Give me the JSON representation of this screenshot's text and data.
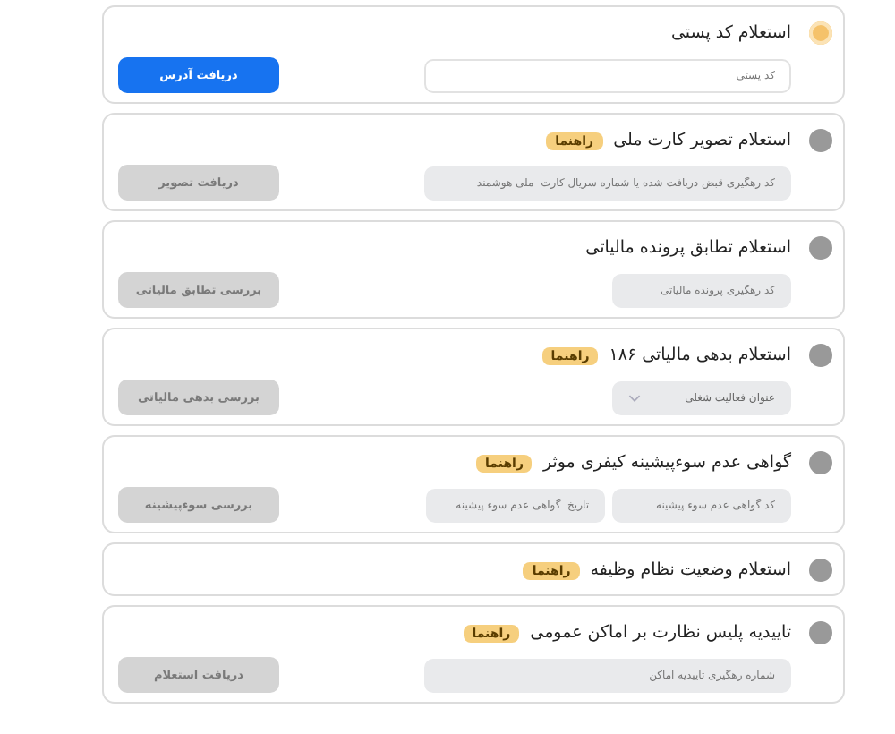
{
  "services": [
    {
      "title": "استعلام کد پستی",
      "selected": true,
      "fields": [
        {
          "kind": "wide",
          "placeholder": "کد پستی"
        }
      ],
      "button": "دریافت آدرس"
    },
    {
      "title": "استعلام تصویر کارت ملی",
      "guide": "راهنما",
      "selected": false,
      "fields": [
        {
          "kind": "wide",
          "placeholder": "کد رهگیری قبض دریافت شده یا شماره سریال کارت  ملی هوشمند"
        }
      ],
      "button": "دریافت تصویر"
    },
    {
      "title": "استعلام تطابق پرونده مالیاتی",
      "selected": false,
      "fields": [
        {
          "kind": "short",
          "placeholder": "کد رهگیری پرونده مالیاتی"
        }
      ],
      "button": "بررسی تطابق مالیاتی"
    },
    {
      "title": "استعلام بدهی مالیاتی ۱۸۶",
      "guide": "راهنما",
      "selected": false,
      "fields": [
        {
          "kind": "select",
          "placeholder": "عنوان فعالیت شغلی"
        }
      ],
      "button": "بررسی بدهی مالیاتی"
    },
    {
      "title": "گواهی عدم سوءپیشینه کیفری موثر",
      "guide": "راهنما",
      "selected": false,
      "fields": [
        {
          "kind": "short",
          "placeholder": "کد گواهی عدم سوء پیشینه"
        },
        {
          "kind": "short",
          "placeholder": "تاریخ  گواهی عدم سوء پیشینه"
        }
      ],
      "button": "بررسی سوءپیشینه"
    },
    {
      "title": "استعلام وضعیت نظام وظیفه",
      "guide": "راهنما",
      "selected": false
    },
    {
      "title": "تاییدیه پلیس نظارت بر اماکن عمومی",
      "guide": "راهنما",
      "selected": false,
      "fields": [
        {
          "kind": "wide",
          "placeholder": "شماره رهگیری تاییدیه اماکن"
        }
      ],
      "button": "دریافت استعلام"
    }
  ]
}
